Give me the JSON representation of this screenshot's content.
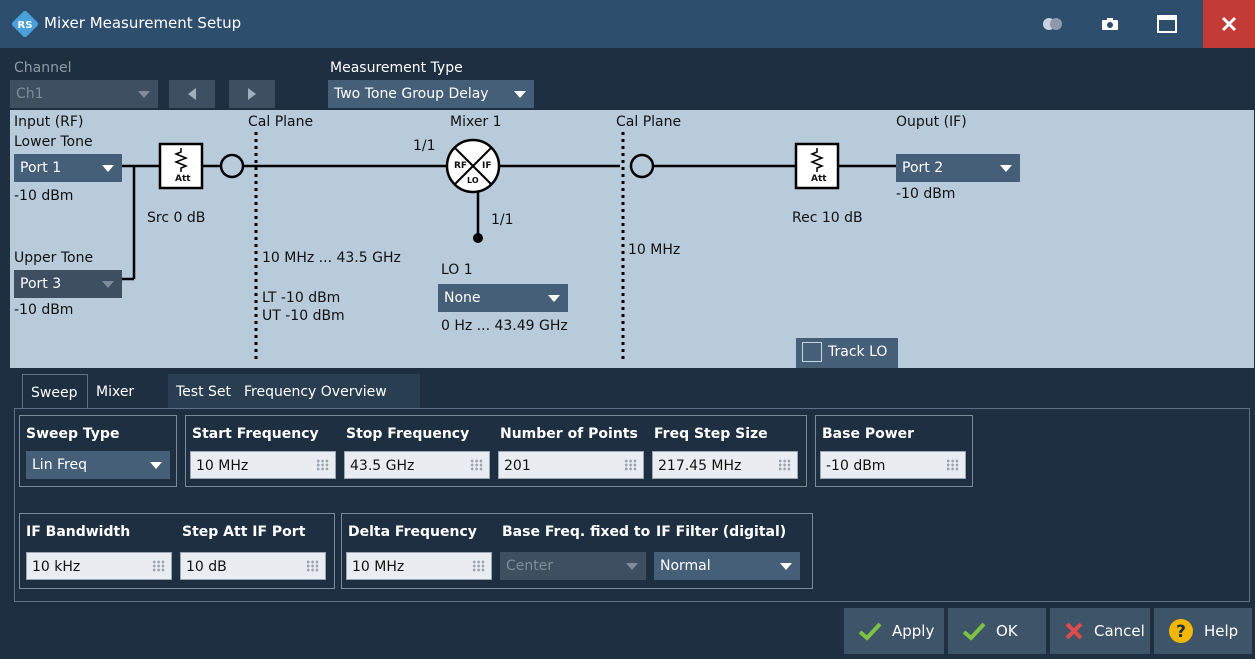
{
  "window": {
    "title": "Mixer Measurement Setup"
  },
  "channel": {
    "label": "Channel",
    "value": "Ch1"
  },
  "measurement_type": {
    "label": "Measurement Type",
    "value": "Two Tone Group Delay"
  },
  "diagram": {
    "input_label": "Input (RF)",
    "lower_tone_label": "Lower Tone",
    "lower_tone_port": "Port 1",
    "lower_tone_power": "-10 dBm",
    "src_label": "Src 0 dB",
    "upper_tone_label": "Upper Tone",
    "upper_tone_port": "Port 3",
    "upper_tone_power": "-10 dBm",
    "cal_plane_1": "Cal Plane",
    "cal_plane_1_range": "10 MHz ... 43.5 GHz",
    "cal_plane_1_lt": "LT -10 dBm",
    "cal_plane_1_ut": "UT -10 dBm",
    "mixer_label": "Mixer 1",
    "mixer_ratio_top": "1/1",
    "mixer_ratio_lo": "1/1",
    "mixer_rf": "RF",
    "mixer_if": "IF",
    "mixer_lo": "LO",
    "att_label": "Att",
    "lo_label": "LO 1",
    "lo_value": "None",
    "lo_range": "0 Hz ... 43.49 GHz",
    "cal_plane_2": "Cal Plane",
    "cal_plane_2_freq": "10 MHz",
    "output_label": "Ouput (IF)",
    "output_port": "Port 2",
    "output_power": "-10 dBm",
    "rec_label": "Rec 10 dB",
    "track_lo_label": "Track LO"
  },
  "tabs": [
    "Sweep",
    "Mixer",
    "Test Set",
    "Frequency Overview"
  ],
  "sweep": {
    "sweep_type_label": "Sweep Type",
    "sweep_type_value": "Lin Freq",
    "start_freq_label": "Start Frequency",
    "start_freq_value": "10 MHz",
    "stop_freq_label": "Stop Frequency",
    "stop_freq_value": "43.5 GHz",
    "num_points_label": "Number of Points",
    "num_points_value": "201",
    "step_size_label": "Freq Step Size",
    "step_size_value": "217.45 MHz",
    "base_power_label": "Base Power",
    "base_power_value": "-10 dBm",
    "if_bw_label": "IF Bandwidth",
    "if_bw_value": "10 kHz",
    "step_att_label": "Step Att IF Port",
    "step_att_value": "10 dB",
    "delta_freq_label": "Delta Frequency",
    "delta_freq_value": "10 MHz",
    "base_fixed_label": "Base Freq. fixed to",
    "base_fixed_value": "Center",
    "if_filter_label": "IF Filter (digital)",
    "if_filter_value": "Normal"
  },
  "buttons": {
    "apply": "Apply",
    "ok": "OK",
    "cancel": "Cancel",
    "help": "Help"
  },
  "colors": {
    "titlebar": "#2e4e6e",
    "close": "#c23b35",
    "diagram_bg": "#b8cbdb",
    "check_green": "#7dc241",
    "cancel_red": "#e04a4a",
    "help_yellow": "#f2b705"
  }
}
